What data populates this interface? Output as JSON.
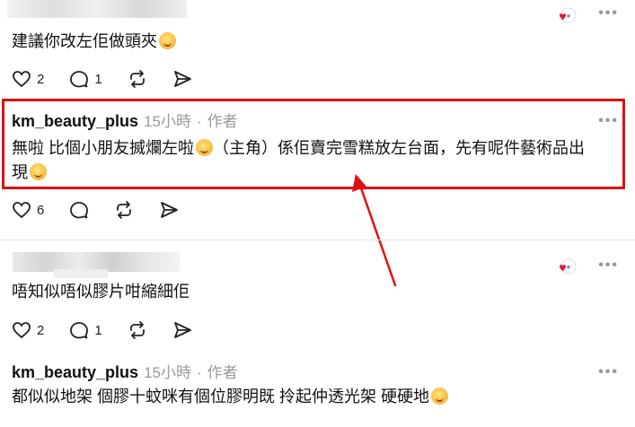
{
  "comments": [
    {
      "text": "建議你改左佢做頭夾",
      "likes": "2",
      "replies": "1"
    },
    {
      "username": "km_beauty_plus",
      "time": "15小時",
      "separator": "·",
      "author_tag": "作者",
      "text_line1": "無啦 比個小朋友搣爛左啦",
      "text_line1b": "（主角）係佢賣完雪糕放左台面，先有呢件藝術品出",
      "text_line2": "現",
      "likes": "6"
    },
    {
      "text": "唔知似唔似膠片咁縮細佢",
      "likes": "2",
      "replies": "1"
    },
    {
      "username": "km_beauty_plus",
      "time": "15小時",
      "separator": "·",
      "author_tag": "作者",
      "text": "都似似地架 個膠十蚊咪有個位膠明既 拎起仲透光架 硬硬地"
    }
  ],
  "icons": {
    "like": "heart-outline-icon",
    "reply": "comment-bubble-icon",
    "repost": "repost-icon",
    "share": "send-icon",
    "more": "more-options-icon",
    "liked_by_author": "liked-by-author-badge-icon"
  },
  "colors": {
    "highlight": "#e01010",
    "arrow": "#e01010",
    "heart_badge": "#e0193a",
    "muted": "#9a9a9a"
  }
}
